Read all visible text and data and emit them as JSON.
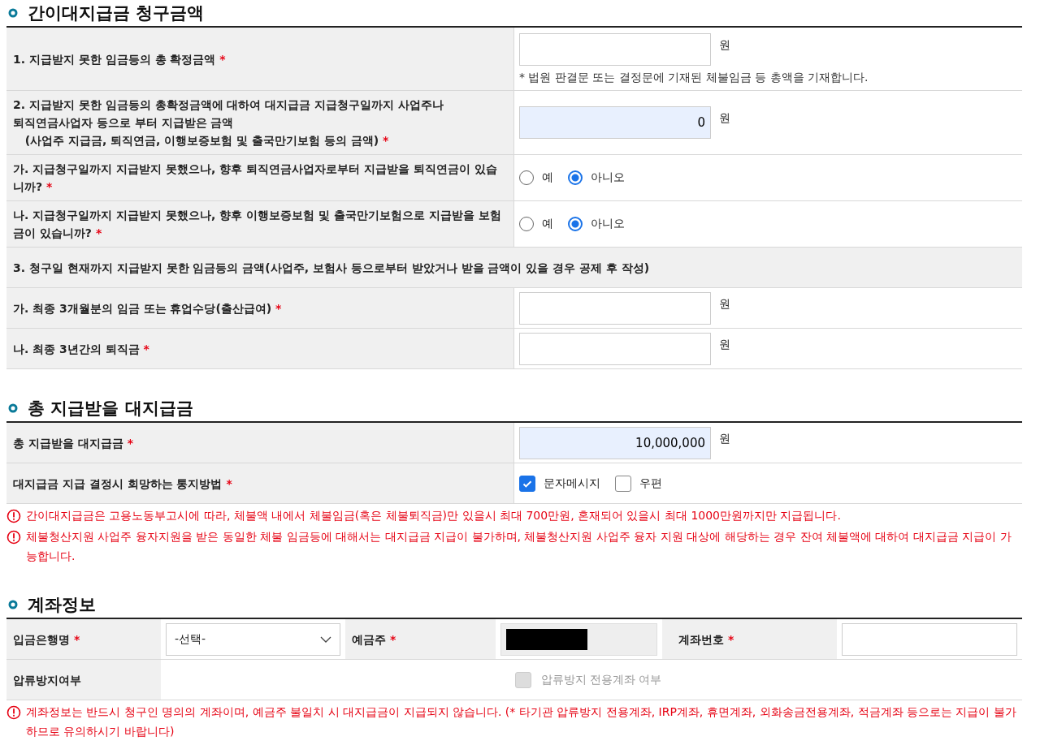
{
  "required_mark": "*",
  "sections": [
    {
      "title": "간이대지급금 청구금액",
      "rows": [
        {
          "kind": "amount",
          "label": "1. 지급받지 못한 임금등의 총 확정금액",
          "required": true,
          "value": "",
          "readonly": false,
          "unit": "원",
          "note": "* 법원 판결문 또는 결정문에 기재된 체불임금 등 총액을 기재합니다."
        },
        {
          "kind": "amount",
          "label": "2. 지급받지 못한 임금등의 총확정금액에 대하여 대지급금 지급청구일까지 사업주나\n퇴직연금사업자 등으로 부터 지급받은 금액\n   (사업주 지급금, 퇴직연금, 이행보증보험 및 출국만기보험 등의 금액)",
          "required": true,
          "value": "0",
          "readonly": true,
          "unit": "원"
        },
        {
          "kind": "radio",
          "label": "가. 지급청구일까지 지급받지 못했으나, 향후 퇴직연금사업자로부터 지급받을 퇴직연금이 있습니까?",
          "required": true,
          "options": [
            {
              "label": "예",
              "selected": false
            },
            {
              "label": "아니오",
              "selected": true
            }
          ]
        },
        {
          "kind": "radio",
          "label": "나. 지급청구일까지 지급받지 못했으나, 향후 이행보증보험 및 출국만기보험으로 지급받을 보험금이 있습니까?",
          "required": true,
          "options": [
            {
              "label": "예",
              "selected": false
            },
            {
              "label": "아니오",
              "selected": true
            }
          ]
        },
        {
          "kind": "heading",
          "label": "3. 청구일 현재까지 지급받지 못한 임금등의 금액(사업주, 보험사 등으로부터 받았거나 받을 금액이 있을 경우 공제 후 작성)",
          "required": false
        },
        {
          "kind": "amount",
          "label": "가. 최종 3개월분의 임금 또는 휴업수당(출산급여)",
          "required": true,
          "value": "",
          "readonly": false,
          "unit": "원"
        },
        {
          "kind": "amount",
          "label": "나. 최종 3년간의 퇴직금",
          "required": true,
          "value": "",
          "readonly": false,
          "unit": "원"
        }
      ]
    },
    {
      "title": "총 지급받을 대지급금",
      "rows": [
        {
          "kind": "amount",
          "label": "총 지급받을 대지급금",
          "required": true,
          "value": "10,000,000",
          "readonly": true,
          "unit": "원"
        },
        {
          "kind": "checks",
          "label": "대지급금 지급 결정시 회망하는 통지방법",
          "required": true,
          "options": [
            {
              "label": "문자메시지",
              "checked": true
            },
            {
              "label": "우편",
              "checked": false
            }
          ]
        }
      ],
      "notices": [
        "간이대지급금은 고용노동부고시에 따라, 체불액 내에서 체불임금(혹은 체불퇴직금)만 있을시 최대 700만원, 혼재되어 있을시 최대 1000만원까지만 지급됩니다.",
        "체불청산지원 사업주 융자지원을 받은 동일한 체불 임금등에 대해서는 대지급금 지급이 불가하며, 체불청산지원  사업주 융자 지원 대상에 해당하는 경우 잔여 체불액에 대하여 대지급금 지급이 가능합니다."
      ]
    }
  ],
  "account": {
    "title": "계좌정보",
    "bank": {
      "label": "입금은행명",
      "required": true,
      "value": "-선택-"
    },
    "holder": {
      "label": "예금주",
      "required": true,
      "redacted": true
    },
    "number": {
      "label": "계좌번호",
      "required": true
    },
    "seizure": {
      "label": "압류방지여부",
      "option": "압류방지 전용계좌 여부",
      "checked": false,
      "disabled": true
    },
    "notice": "계좌정보는 반드시 청구인 명의의 계좌이며, 예금주 불일치 시 대지급금이 지급되지 않습니다. (* 타기관 압류방지 전용계좌, IRP계좌, 휴면계좌, 외화송금전용계좌, 적금계좌 등으로는 지급이 불가하므로 유의하시기 바랍니다)"
  }
}
